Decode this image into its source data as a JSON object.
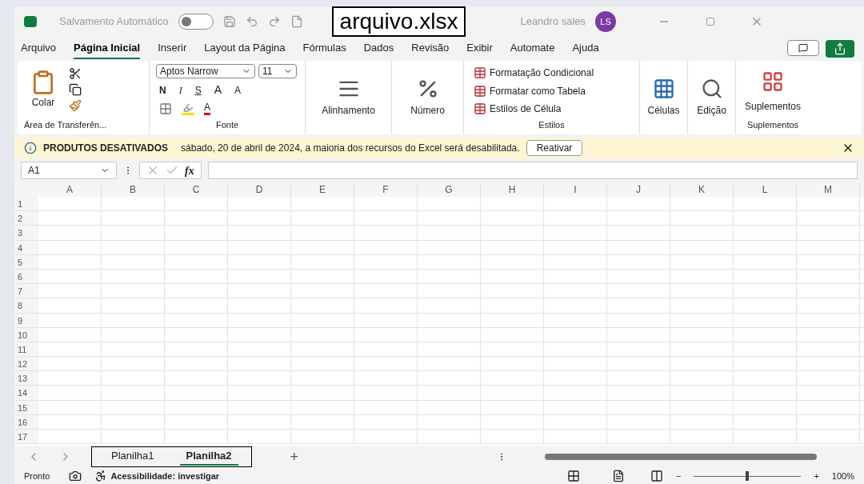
{
  "title_bar": {
    "autosave_label": "Salvamento Automático",
    "autosave_on": false,
    "file_name": "arquivo.xlsx",
    "user_name": "Leandro sales",
    "user_initials": "LS"
  },
  "menu_tabs": [
    {
      "label": "Arquivo",
      "selected": false
    },
    {
      "label": "Página Inicial",
      "selected": true
    },
    {
      "label": "Inserir",
      "selected": false
    },
    {
      "label": "Layout da Página",
      "selected": false
    },
    {
      "label": "Fórmulas",
      "selected": false
    },
    {
      "label": "Dados",
      "selected": false
    },
    {
      "label": "Revisão",
      "selected": false
    },
    {
      "label": "Exibir",
      "selected": false
    },
    {
      "label": "Automate",
      "selected": false
    },
    {
      "label": "Ajuda",
      "selected": false
    }
  ],
  "ribbon": {
    "clipboard": {
      "paste": "Colar",
      "group": "Área de Transferên..."
    },
    "font": {
      "font_name": "Aptos Narrow",
      "font_size": "11",
      "bold": "N",
      "italic": "I",
      "underline": "S",
      "grow": "A",
      "shrink": "A",
      "font_color_letter": "A",
      "group": "Fonte"
    },
    "alignment": {
      "label": "Alinhamento"
    },
    "number": {
      "label": "Número"
    },
    "styles": {
      "items": [
        "Formatação Condicional",
        "Formatar como Tabela",
        "Estilos de Célula"
      ],
      "group": "Estilos"
    },
    "cells": {
      "label": "Células"
    },
    "editing": {
      "label": "Edição"
    },
    "addins": {
      "label": "Suplementos",
      "group": "Suplementos"
    }
  },
  "message_bar": {
    "title": "PRODUTOS DESATIVADOS",
    "text": "sábado, 20 de abril de 2024, a maioria dos recursos do Excel será desabilitada.",
    "button": "Reativar"
  },
  "formula_bar": {
    "name_box": "A1",
    "fx": "fx"
  },
  "grid": {
    "columns": [
      "A",
      "B",
      "C",
      "D",
      "E",
      "F",
      "G",
      "H",
      "I",
      "J",
      "K",
      "L",
      "M"
    ],
    "rows": [
      "1",
      "2",
      "3",
      "4",
      "5",
      "6",
      "7",
      "8",
      "9",
      "10",
      "11",
      "12",
      "13",
      "14",
      "15",
      "16",
      "17"
    ]
  },
  "sheet_tabs": [
    {
      "label": "Planilha1",
      "selected": false
    },
    {
      "label": "Planilha2",
      "selected": true
    }
  ],
  "add_sheet": "+",
  "status_bar": {
    "status": "Pronto",
    "accessibility": "Acessibilidade: investigar",
    "zoom_minus": "−",
    "zoom_plus": "+",
    "zoom": "100%",
    "level": 0.5
  }
}
